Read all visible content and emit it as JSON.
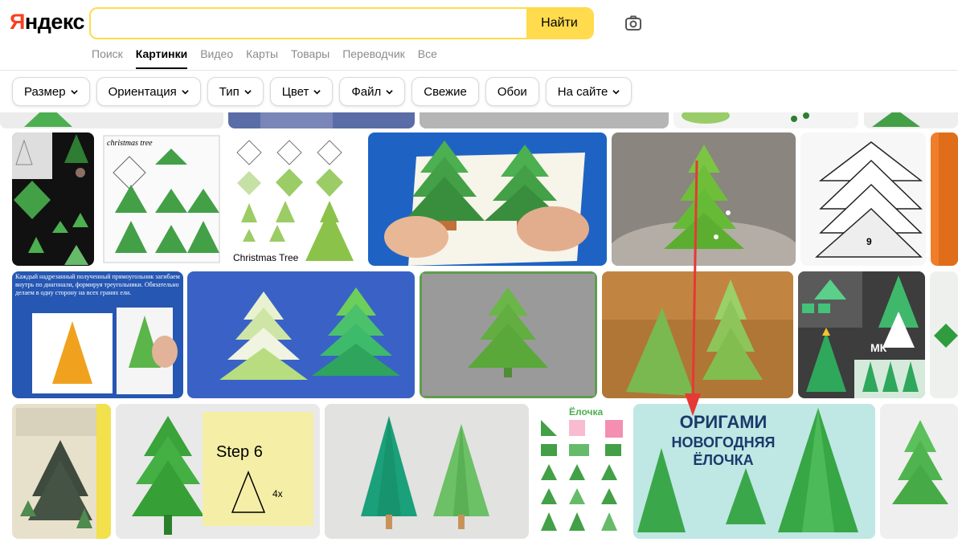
{
  "logo": "Яндекс",
  "search": {
    "value": "",
    "placeholder": "",
    "button_label": "Найти"
  },
  "nav": [
    {
      "label": "Поиск",
      "active": false
    },
    {
      "label": "Картинки",
      "active": true
    },
    {
      "label": "Видео",
      "active": false
    },
    {
      "label": "Карты",
      "active": false
    },
    {
      "label": "Товары",
      "active": false
    },
    {
      "label": "Переводчик",
      "active": false
    },
    {
      "label": "Все",
      "active": false
    }
  ],
  "filters": [
    {
      "label": "Размер",
      "dropdown": true
    },
    {
      "label": "Ориентация",
      "dropdown": true
    },
    {
      "label": "Тип",
      "dropdown": true
    },
    {
      "label": "Цвет",
      "dropdown": true
    },
    {
      "label": "Файл",
      "dropdown": true
    },
    {
      "label": "Свежие",
      "dropdown": false
    },
    {
      "label": "Обои",
      "dropdown": false
    },
    {
      "label": "На сайте",
      "dropdown": true
    }
  ],
  "image_texts": {
    "christmas_tree_label": "Christmas Tree",
    "diagram_title": "christmas tree",
    "fold_instruction": "Каждый надрезанный полученный прямоугольник загибаем внутрь по диагонали, формируя треугольники. Обязательно делаем в одну сторону на всех гранях ели.",
    "step_note": "Step 6",
    "step_multiplier": "4x",
    "step_number": "9",
    "banner_title_line1": "ОРИГАМИ",
    "banner_title_line2": "НОВОГОДНЯЯ",
    "banner_title_line3": "ЁЛОЧКА",
    "small_title": "Ёлочка",
    "mk_label": "МК"
  },
  "colors": {
    "accent_yellow": "#ffdb4d",
    "logo_red": "#fc3f1d",
    "annotation_red": "#e53935"
  }
}
